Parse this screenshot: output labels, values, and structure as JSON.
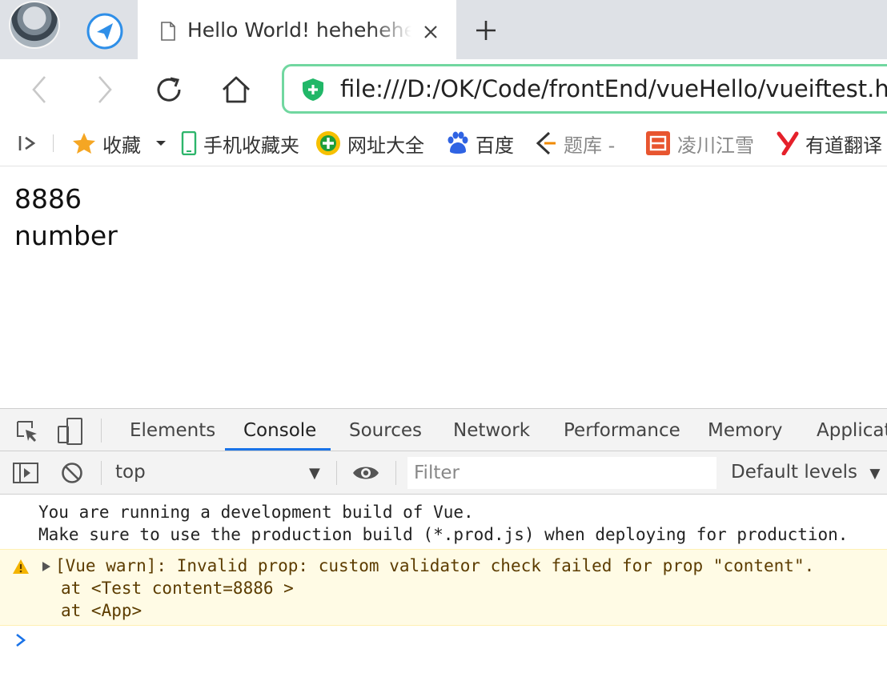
{
  "browser": {
    "tab": {
      "title": "Hello World! hehehehehe"
    },
    "address_url": "file:///D:/OK/Code/frontEnd/vueHello/vueiftest.html",
    "bookmarks": [
      {
        "label": "收藏",
        "icon": "star-icon"
      },
      {
        "label": "手机收藏夹",
        "icon": "phone-icon"
      },
      {
        "label": "网址大全",
        "icon": "web-directory-icon"
      },
      {
        "label": "百度",
        "icon": "baidu-paw-icon"
      },
      {
        "label": "题库 -",
        "icon": "question-bank-icon"
      },
      {
        "label": "凌川江雪",
        "icon": "jian-icon"
      },
      {
        "label": "有道翻译",
        "icon": "youdao-icon"
      }
    ]
  },
  "page": {
    "lines": [
      "8886",
      "number"
    ]
  },
  "devtools": {
    "tabs": [
      "Elements",
      "Console",
      "Sources",
      "Network",
      "Performance",
      "Memory",
      "Applicat"
    ],
    "active_tab": "Console",
    "context": "top",
    "filter_placeholder": "Filter",
    "levels": "Default levels",
    "messages": [
      "You are running a development build of Vue.",
      "Make sure to use the production build (*.prod.js) when deploying for production."
    ],
    "warning": {
      "text": "[Vue warn]: Invalid prop: custom validator check failed for prop \"content\".",
      "trace": [
        "at <Test content=8886 >",
        "at <App>"
      ]
    }
  },
  "colors": {
    "accent": "#1a73e8",
    "address_border": "#71d7a0",
    "warning_bg": "#fffbe5",
    "warning_text": "#5c3c00"
  }
}
